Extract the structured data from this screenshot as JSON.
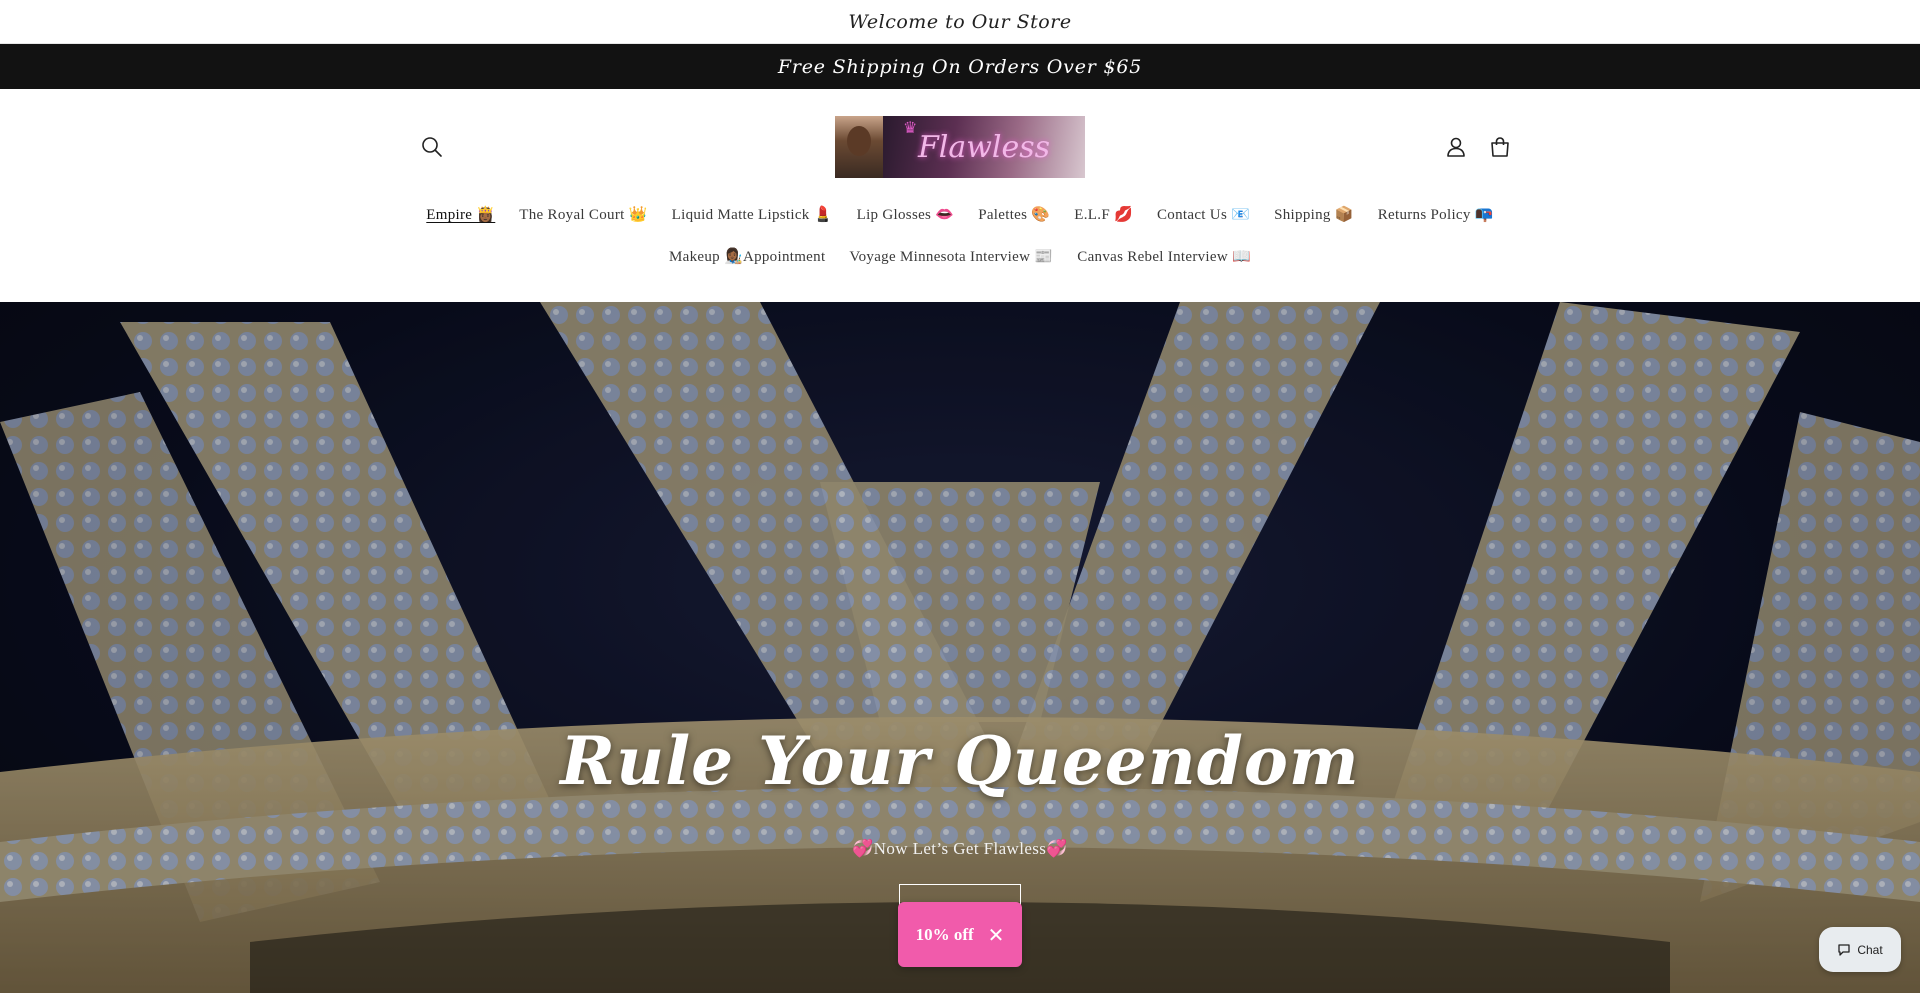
{
  "announcement": {
    "welcome": "Welcome to Our Store"
  },
  "shipping_bar": {
    "text": "Free Shipping On Orders Over $65"
  },
  "header": {
    "logo_text": "Flawless",
    "icons": {
      "search": "search-icon",
      "account": "account-icon",
      "cart": "cart-icon"
    }
  },
  "nav": {
    "row1": [
      {
        "label": "Empire 👸🏾",
        "active": true
      },
      {
        "label": "The Royal Court 👑"
      },
      {
        "label": "Liquid Matte Lipstick 💄"
      },
      {
        "label": "Lip Glosses 👄"
      },
      {
        "label": "Palettes 🎨"
      },
      {
        "label": "E.L.F 💋"
      },
      {
        "label": "Contact Us 📧"
      },
      {
        "label": "Shipping 📦"
      },
      {
        "label": "Returns Policy 📭"
      }
    ],
    "row2": [
      {
        "label": "Makeup 👩🏾‍🎨Appointment"
      },
      {
        "label": "Voyage Minnesota Interview 📰"
      },
      {
        "label": "Canvas Rebel Interview 📖"
      }
    ]
  },
  "hero": {
    "title": "Rule Your Queendom",
    "subtitle": "💞Now Let’s Get Flawless💞"
  },
  "discount_popup": {
    "label": "10% off",
    "close": "✕"
  },
  "chat_widget": {
    "label": "Chat"
  },
  "colors": {
    "accent_pink": "#f15bab",
    "shipbar_bg": "#121212"
  }
}
